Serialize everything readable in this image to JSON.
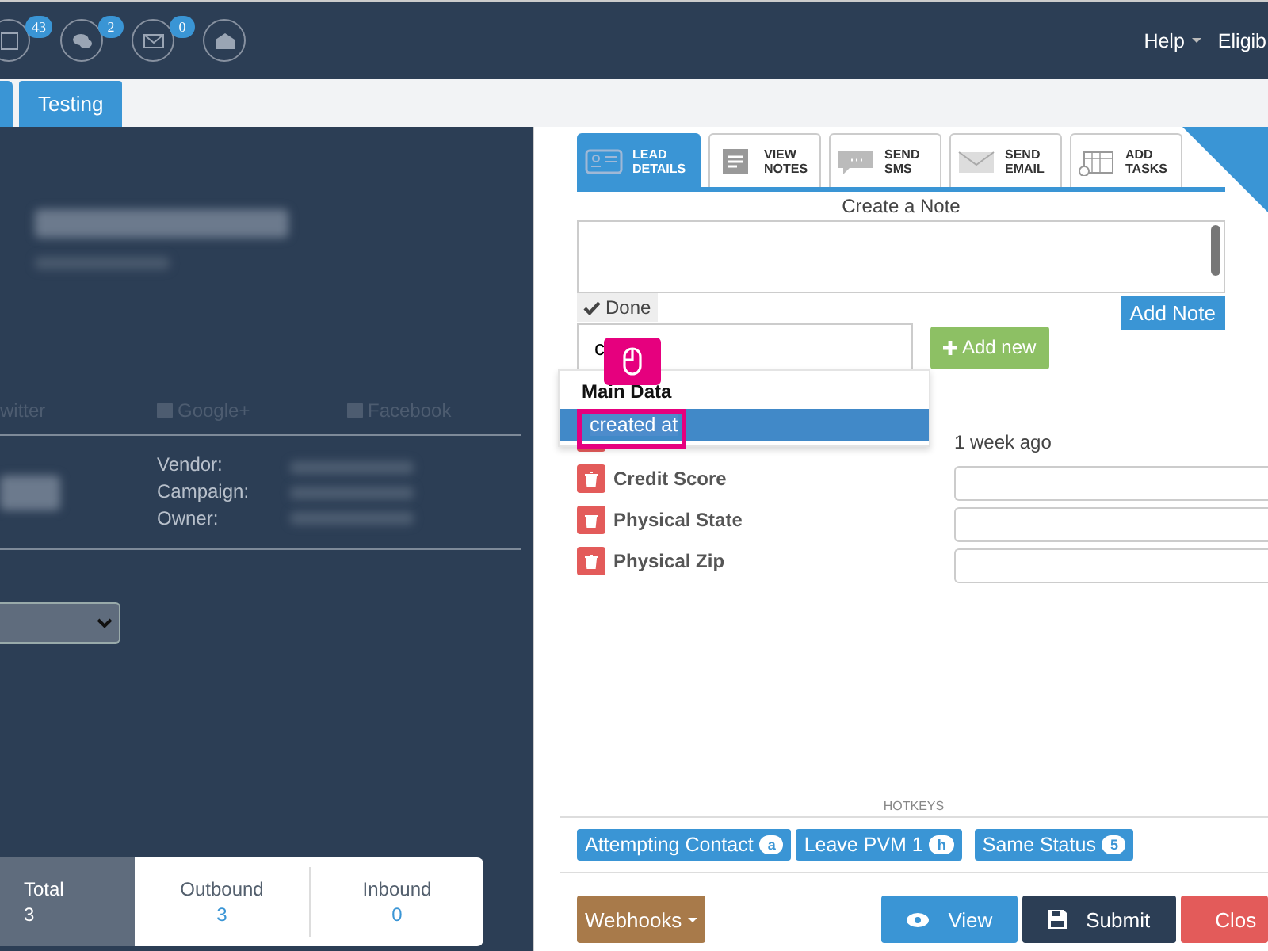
{
  "topbar": {
    "icons": [
      {
        "kind": "clipboard",
        "count": "43"
      },
      {
        "kind": "chat",
        "count": "2"
      },
      {
        "kind": "mail",
        "count": "0"
      },
      {
        "kind": "open-mail"
      }
    ],
    "menu": [
      {
        "label": "Help",
        "caret": true
      },
      {
        "label": "Eligib"
      }
    ]
  },
  "tabs": [
    {
      "label": "Testing",
      "selected": true
    }
  ],
  "lead": {
    "social": [
      {
        "kind": "twitter",
        "label": "witter"
      },
      {
        "kind": "google",
        "label": "Google+"
      },
      {
        "kind": "facebook",
        "label": "Facebook"
      }
    ],
    "info_labels": [
      "Vendor:",
      "Campaign:",
      "Owner:"
    ]
  },
  "stats": [
    {
      "label": "Total",
      "value": "3",
      "selected": true
    },
    {
      "label": "Outbound",
      "value": "3",
      "selected": false
    },
    {
      "label": "Inbound",
      "value": "0",
      "selected": false
    }
  ],
  "action_tabs": [
    {
      "kind": "card",
      "line1": "LEAD",
      "line2": "DETAILS",
      "selected": true
    },
    {
      "kind": "notes",
      "line1": "VIEW",
      "line2": "NOTES",
      "selected": false
    },
    {
      "kind": "sms",
      "line1": "SEND",
      "line2": "SMS",
      "selected": false
    },
    {
      "kind": "email",
      "line1": "SEND",
      "line2": "EMAIL",
      "selected": false
    },
    {
      "kind": "tasks",
      "line1": "ADD",
      "line2": "TASKS",
      "selected": false
    }
  ],
  "note": {
    "title": "Create a Note",
    "done": "Done",
    "add_note": "Add Note"
  },
  "search": {
    "value": "c",
    "add_new": "Add new"
  },
  "suggestions": {
    "group": "Main Data",
    "items": [
      {
        "label": "created at",
        "selected": true
      }
    ]
  },
  "fields": [
    {
      "kind": "text",
      "value": "1 week ago"
    },
    {
      "kind": "input",
      "label": "Credit Score"
    },
    {
      "kind": "input",
      "label": "Physical State"
    },
    {
      "kind": "input",
      "label": "Physical Zip"
    }
  ],
  "hotkeys": {
    "title": "HOTKEYS",
    "items": [
      {
        "label": "Attempting Contact",
        "key": "a"
      },
      {
        "label": "Leave PVM 1",
        "key": "h"
      },
      {
        "label": "Same Status",
        "key": "5"
      }
    ]
  },
  "buttons": [
    {
      "kind": "webhooks",
      "label": "Webhooks"
    },
    {
      "kind": "view",
      "label": "View"
    },
    {
      "kind": "submit",
      "label": "Submit"
    },
    {
      "kind": "close",
      "label": "Clos"
    }
  ]
}
